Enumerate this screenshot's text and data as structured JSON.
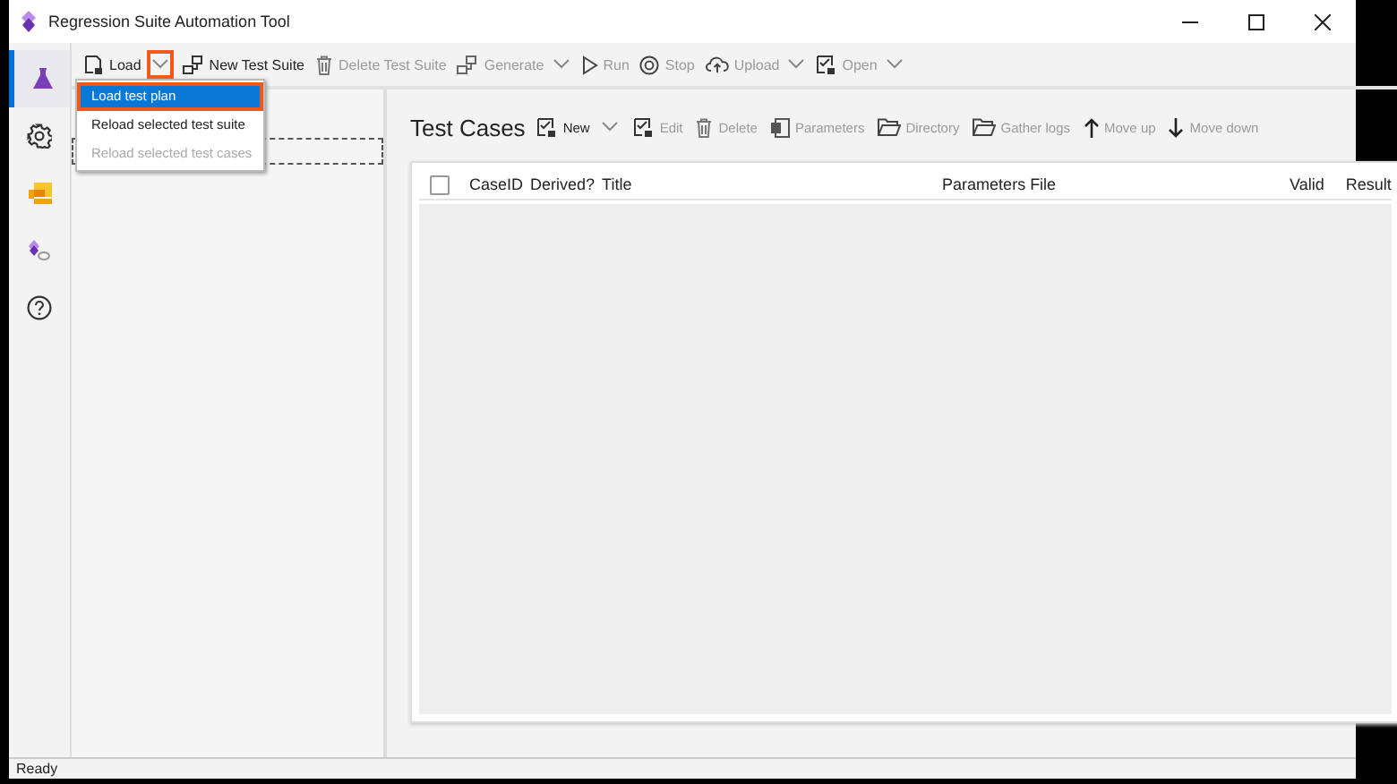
{
  "window": {
    "title": "Regression Suite Automation Tool"
  },
  "rail": [
    {
      "selected": true
    },
    {
      "selected": false
    },
    {
      "selected": false
    },
    {
      "selected": false
    },
    {
      "selected": false
    }
  ],
  "toolbar": [
    {
      "label": "Load",
      "disabled": false,
      "dropdown": true,
      "dropdown_highlighted": true
    },
    {
      "label": "New Test Suite",
      "disabled": false,
      "dropdown": false
    },
    {
      "label": "Delete Test Suite",
      "disabled": true,
      "dropdown": false
    },
    {
      "label": "Generate",
      "disabled": true,
      "dropdown": true,
      "dropdown_highlighted": false
    },
    {
      "label": "Run",
      "disabled": true,
      "dropdown": false
    },
    {
      "label": "Stop",
      "disabled": true,
      "dropdown": false
    },
    {
      "label": "Upload",
      "disabled": true,
      "dropdown": true,
      "dropdown_highlighted": false
    },
    {
      "label": "Open",
      "disabled": true,
      "dropdown": true,
      "dropdown_highlighted": false
    }
  ],
  "load_menu": [
    {
      "label": "Load test plan",
      "selected": true,
      "disabled": false
    },
    {
      "label": "Reload selected test suite",
      "selected": false,
      "disabled": false
    },
    {
      "label": "Reload selected test cases",
      "selected": false,
      "disabled": true
    }
  ],
  "test_cases": {
    "title": "Test Cases",
    "toolbar": [
      {
        "label": "New",
        "disabled": false,
        "dropdown": true
      },
      {
        "label": "Edit",
        "disabled": true,
        "dropdown": false
      },
      {
        "label": "Delete",
        "disabled": true,
        "dropdown": false
      },
      {
        "label": "Parameters",
        "disabled": true,
        "dropdown": false
      },
      {
        "label": "Directory",
        "disabled": true,
        "dropdown": false
      },
      {
        "label": "Gather logs",
        "disabled": true,
        "dropdown": false
      },
      {
        "label": "Move up",
        "disabled": true,
        "dropdown": false
      },
      {
        "label": "Move down",
        "disabled": true,
        "dropdown": false
      }
    ],
    "select_all_checked": false,
    "columns": [
      "CaseID",
      "Derived?",
      "Title",
      "Parameters File",
      "Valid",
      "Result"
    ]
  },
  "status_bar": "Ready"
}
